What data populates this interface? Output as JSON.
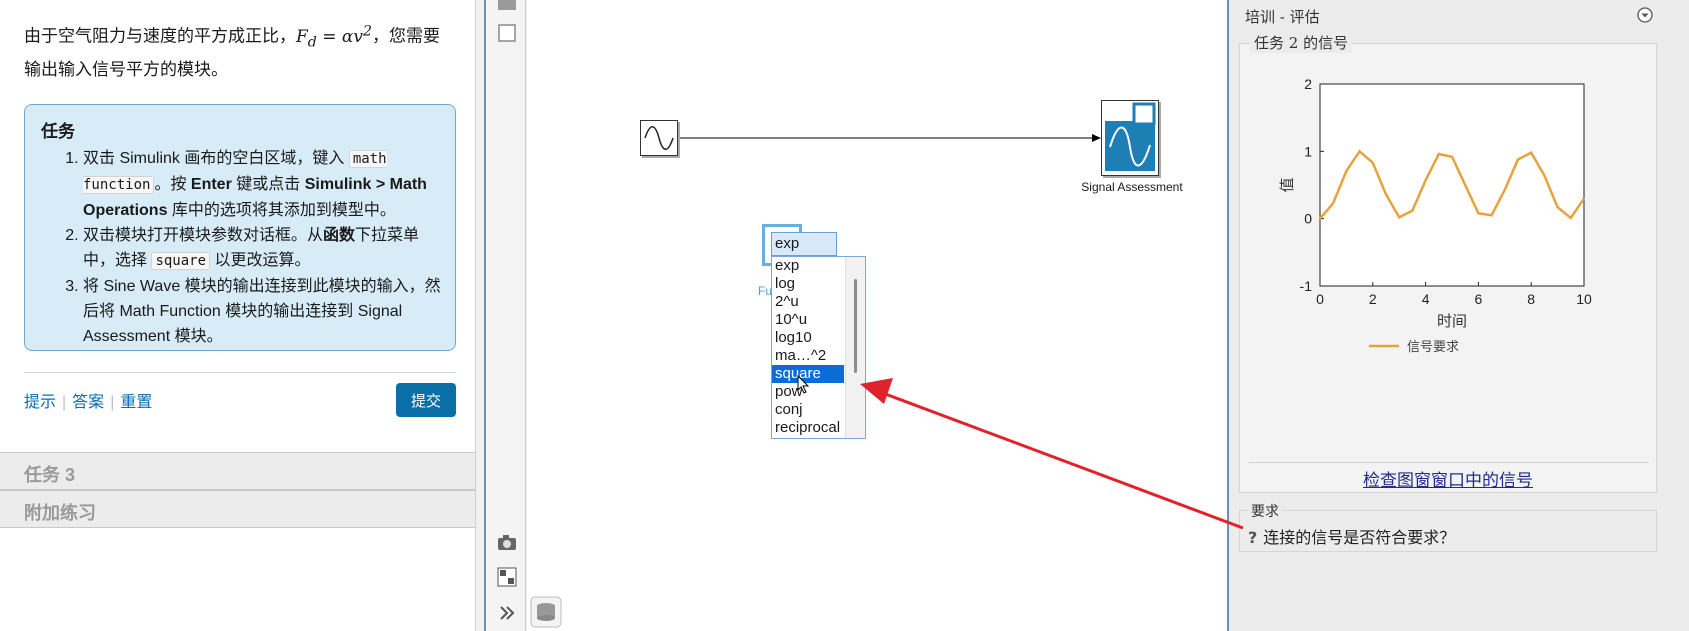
{
  "left": {
    "intro_before": "由于空气阻力与速度的平方成正比，",
    "formula": "F",
    "formula_sub": "d",
    "formula_rhs": " = αv",
    "formula_sup": "2",
    "intro_after": "，您需要输出输入信号平方的模块。",
    "task": {
      "title": "任务",
      "step1_a": "双击 Simulink 画布的空白区域，键入 ",
      "step1_code": "math function",
      "step1_b": "。按 ",
      "step1_enter": "Enter",
      "step1_c": " 键或点击 ",
      "step1_lib": "Simulink > Math Operations",
      "step1_d": " 库中的选项将其添加到模型中。",
      "step2_a": "双击模块打开模块参数对话框。从",
      "step2_bold": "函数",
      "step2_b": "下拉菜单中，选择 ",
      "step2_code": "square",
      "step2_c": " 以更改运算。",
      "step3": "将 Sine Wave 模块的输出连接到此模块的输入，然后将 Math Function 模块的输出连接到 Signal Assessment 模块。"
    },
    "links": {
      "hint": "提示",
      "answer": "答案",
      "reset": "重置"
    },
    "submit": "提交",
    "section3": "任务 3",
    "section_extra": "附加练习"
  },
  "canvas": {
    "signal_assessment_label": "Signal Assessment",
    "math_label": "Fu",
    "combo_value": "exp",
    "options": [
      "exp",
      "log",
      "2^u",
      "10^u",
      "log10",
      "ma…^2",
      "square",
      "pow",
      "conj",
      "reciprocal"
    ],
    "selected_option": "square"
  },
  "right": {
    "header": "培训 - 评估",
    "plot_title": "任务 2 的信号",
    "check_link": "检查图窗窗口中的信号",
    "req_title": "要求",
    "req_text": "连接的信号是否符合要求？"
  },
  "chart_data": {
    "type": "line",
    "title": "",
    "xlabel": "时间",
    "ylabel": "值",
    "xlim": [
      0,
      10
    ],
    "ylim": [
      -1,
      2
    ],
    "xticks": [
      0,
      2,
      4,
      6,
      8,
      10
    ],
    "yticks": [
      -1,
      0,
      1,
      2
    ],
    "legend": "bottom",
    "series": [
      {
        "name": "信号要求",
        "color": "#e8a23c",
        "x": [
          0,
          0.5,
          1,
          1.5,
          2,
          2.5,
          3,
          3.5,
          4,
          4.5,
          5,
          5.5,
          6,
          6.5,
          7,
          7.5,
          8,
          8.5,
          9,
          9.5,
          10
        ],
        "y": [
          0,
          0.23,
          0.71,
          1.0,
          0.83,
          0.36,
          0.02,
          0.12,
          0.57,
          0.96,
          0.92,
          0.5,
          0.08,
          0.05,
          0.43,
          0.88,
          0.98,
          0.64,
          0.17,
          0.01,
          0.3
        ]
      }
    ]
  }
}
